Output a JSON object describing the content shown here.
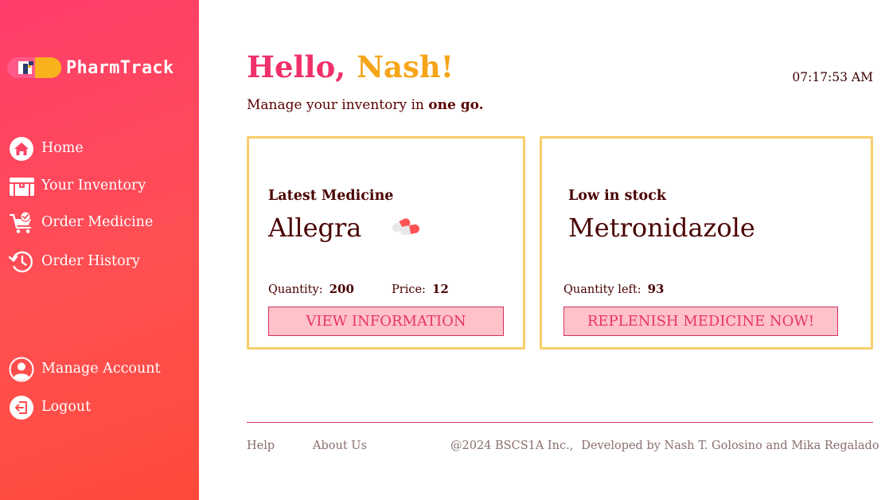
{
  "brand": {
    "name": "PharmTrack",
    "logo_icon": "pill-capsule-logo-icon"
  },
  "nav": {
    "home": {
      "label": "Home",
      "icon": "home-icon"
    },
    "inventory": {
      "label": "Your Inventory",
      "icon": "chest-icon"
    },
    "order": {
      "label": "Order Medicine",
      "icon": "cart-icon"
    },
    "history": {
      "label": "Order History",
      "icon": "history-icon"
    },
    "account": {
      "label": "Manage Account",
      "icon": "user-icon"
    },
    "logout": {
      "label": "Logout",
      "icon": "logout-icon"
    }
  },
  "header": {
    "hello": "Hello,",
    "name": "Nash!",
    "time": "07:17:53 AM",
    "subtitle_prefix": "Manage your inventory in ",
    "subtitle_bold": "one go."
  },
  "latest_card": {
    "title": "Latest Medicine",
    "medicine": "Allegra",
    "quantity_label": "Quantity:",
    "quantity_value": "200",
    "price_label": "Price:",
    "price_value": "12",
    "button": "VIEW INFORMATION",
    "icon": "capsule-icon"
  },
  "low_stock_card": {
    "title": "Low in stock",
    "medicine": "Metronidazole",
    "quantity_label": "Quantity left:",
    "quantity_value": "93",
    "button": "REPLENISH MEDICINE NOW!"
  },
  "footer": {
    "help": "Help",
    "about": "About Us",
    "copyright": "@2024 BSCS1A Inc.,",
    "developers": "Developed by Nash T. Golosino and Mika Regalado"
  },
  "colors": {
    "sidebar_top": "#ff3d6c",
    "sidebar_bottom": "#ff4a3a",
    "hello": "#f0306a",
    "name": "#f6a418",
    "card_border": "#f8ce6a",
    "button_bg": "#ffc2c8",
    "button_text": "#e8336c"
  }
}
